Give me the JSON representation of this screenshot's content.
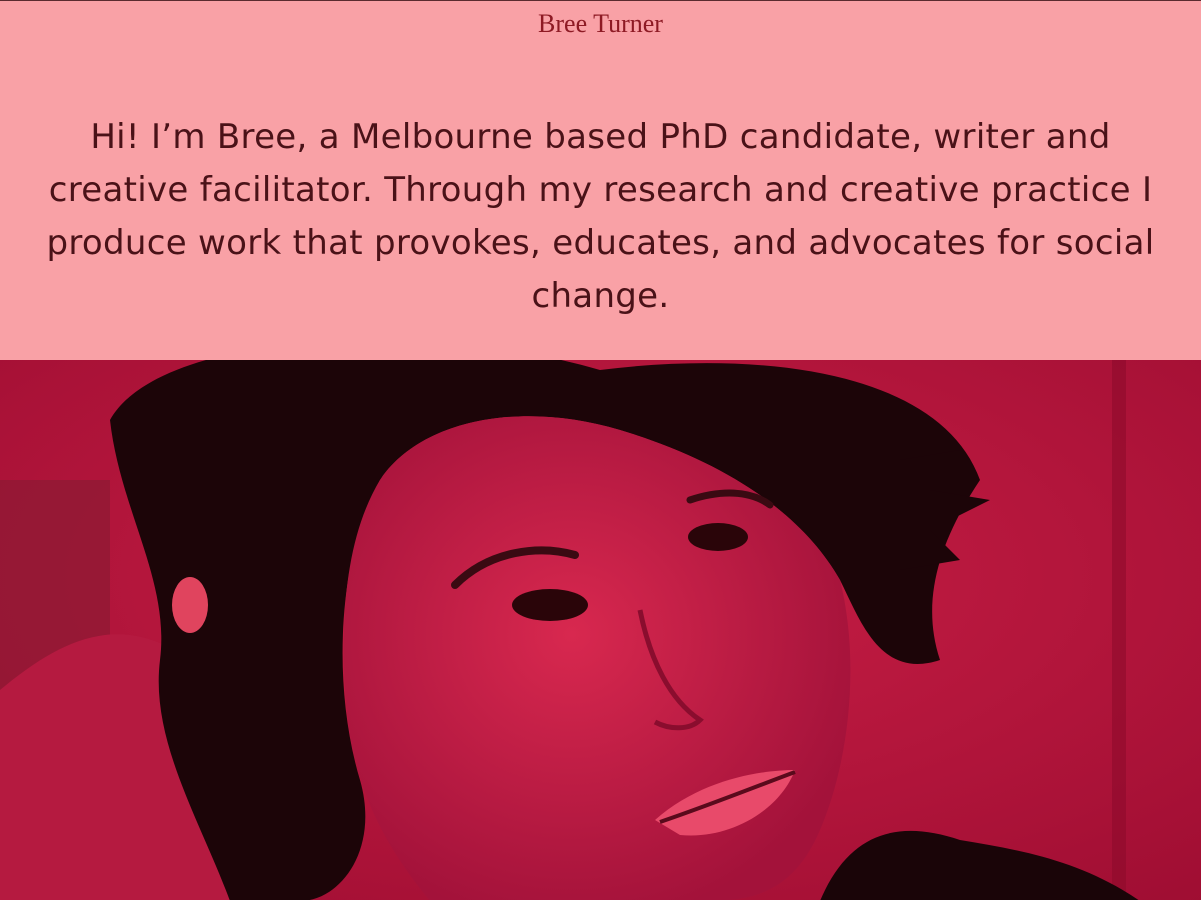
{
  "site": {
    "title": "Bree Turner"
  },
  "intro": {
    "text": "Hi! I’m Bree, a Melbourne based PhD candidate, writer and creative facilitator. Through my research and creative practice I produce work that provokes, educates, and advocates for social change."
  },
  "hero": {
    "tint_color": "#c4173f",
    "background_color": "#f9a1a6",
    "description_icon": "portrait-photo"
  }
}
